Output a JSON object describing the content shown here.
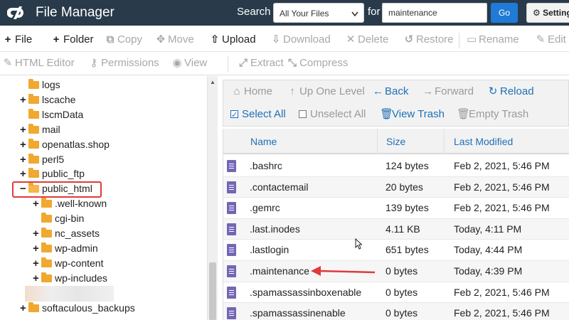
{
  "header": {
    "title": "File Manager",
    "search_label": "Search",
    "search_scope": "All Your Files",
    "for_label": "for",
    "search_value": "maintenance",
    "go_label": "Go",
    "settings_label": "Setting"
  },
  "toolbar1": [
    {
      "label": "File",
      "icon": "plus-icon",
      "glyph": "+",
      "enabled": true
    },
    {
      "label": "Folder",
      "icon": "plus-icon",
      "glyph": "+",
      "enabled": true
    },
    {
      "label": "Copy",
      "icon": "copy-icon",
      "glyph": "⧉",
      "enabled": false
    },
    {
      "label": "Move",
      "icon": "move-icon",
      "glyph": "✥",
      "enabled": false
    },
    {
      "label": "Upload",
      "icon": "upload-icon",
      "glyph": "⇧",
      "enabled": true
    },
    {
      "label": "Download",
      "icon": "download-icon",
      "glyph": "⇩",
      "enabled": false
    },
    {
      "label": "Delete",
      "icon": "delete-icon",
      "glyph": "✕",
      "enabled": false
    },
    {
      "label": "Restore",
      "icon": "restore-icon",
      "glyph": "↺",
      "enabled": false
    },
    {
      "label": "Rename",
      "icon": "rename-icon",
      "glyph": "▭",
      "enabled": false
    },
    {
      "label": "Edit",
      "icon": "edit-icon",
      "glyph": "✎",
      "enabled": false
    }
  ],
  "toolbar2": [
    {
      "label": "HTML Editor",
      "icon": "html-editor-icon",
      "glyph": "✎",
      "enabled": false
    },
    {
      "label": "Permissions",
      "icon": "key-icon",
      "glyph": "⚷",
      "enabled": false
    },
    {
      "label": "View",
      "icon": "eye-icon",
      "glyph": "◉",
      "enabled": false
    },
    {
      "label": "Extract",
      "icon": "extract-icon",
      "glyph": "⤢",
      "enabled": false
    },
    {
      "label": "Compress",
      "icon": "compress-icon",
      "glyph": "⤡",
      "enabled": false
    }
  ],
  "tree": [
    {
      "label": "logs",
      "toggle": "",
      "indent": 1
    },
    {
      "label": "lscache",
      "toggle": "+",
      "indent": 1
    },
    {
      "label": "lscmData",
      "toggle": "",
      "indent": 1
    },
    {
      "label": "mail",
      "toggle": "+",
      "indent": 1
    },
    {
      "label": "openatlas.shop",
      "toggle": "+",
      "indent": 1
    },
    {
      "label": "perl5",
      "toggle": "+",
      "indent": 1
    },
    {
      "label": "public_ftp",
      "toggle": "+",
      "indent": 1
    },
    {
      "label": "public_html",
      "toggle": "−",
      "indent": 1,
      "open": true
    },
    {
      "label": ".well-known",
      "toggle": "+",
      "indent": 2
    },
    {
      "label": "cgi-bin",
      "toggle": "",
      "indent": 2
    },
    {
      "label": "nc_assets",
      "toggle": "+",
      "indent": 2
    },
    {
      "label": "wp-admin",
      "toggle": "+",
      "indent": 2
    },
    {
      "label": "wp-content",
      "toggle": "+",
      "indent": 2
    },
    {
      "label": "wp-includes",
      "toggle": "+",
      "indent": 2
    },
    {
      "label": "",
      "toggle": "",
      "indent": 1,
      "blurred": true
    },
    {
      "label": "softaculous_backups",
      "toggle": "+",
      "indent": 1
    }
  ],
  "nav": {
    "home": "Home",
    "up": "Up One Level",
    "back": "Back",
    "forward": "Forward",
    "reload": "Reload",
    "select_all": "Select All",
    "unselect_all": "Unselect All",
    "view_trash": "View Trash",
    "empty_trash": "Empty Trash"
  },
  "table": {
    "headers": [
      "Name",
      "Size",
      "Last Modified"
    ],
    "rows": [
      {
        "name": ".bashrc",
        "size": "124 bytes",
        "modified": "Feb 2, 2021, 5:46 PM"
      },
      {
        "name": ".contactemail",
        "size": "20 bytes",
        "modified": "Feb 2, 2021, 5:46 PM"
      },
      {
        "name": ".gemrc",
        "size": "139 bytes",
        "modified": "Feb 2, 2021, 5:46 PM"
      },
      {
        "name": ".last.inodes",
        "size": "4.11 KB",
        "modified": "Today, 4:11 PM"
      },
      {
        "name": ".lastlogin",
        "size": "651 bytes",
        "modified": "Today, 4:44 PM"
      },
      {
        "name": ".maintenance",
        "size": "0 bytes",
        "modified": "Today, 4:39 PM"
      },
      {
        "name": ".spamassassinboxenable",
        "size": "0 bytes",
        "modified": "Feb 2, 2021, 5:46 PM"
      },
      {
        "name": ".spamassassinenable",
        "size": "0 bytes",
        "modified": "Feb 2, 2021, 5:46 PM"
      }
    ]
  },
  "colors": {
    "header_bg": "#293a4a",
    "accent": "#1f7bd6",
    "link": "#1f6fb8",
    "file_icon": "#7466b5",
    "folder": "#f0a830",
    "annotation_red": "#e03a3a"
  }
}
